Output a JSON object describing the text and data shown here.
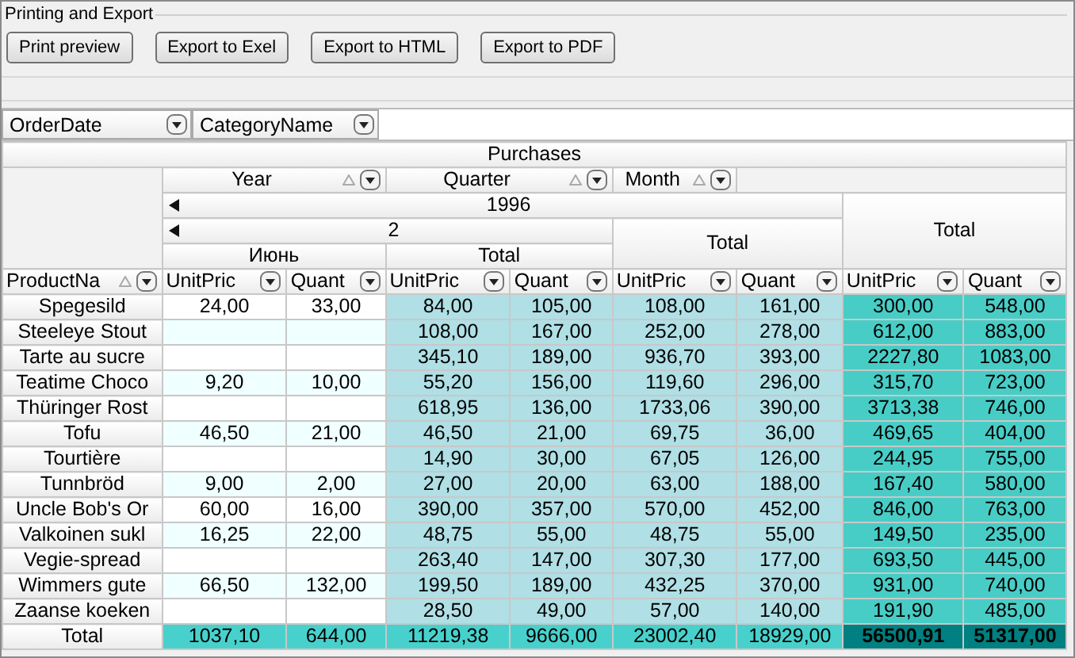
{
  "panel": {
    "title": "Printing and Export",
    "buttons": [
      "Print preview",
      "Export to Exel",
      "Export to HTML",
      "Export to PDF"
    ]
  },
  "filter_fields": [
    {
      "label": "OrderDate"
    },
    {
      "label": "CategoryName"
    }
  ],
  "pivot": {
    "title": "Purchases",
    "column_fields": [
      {
        "label": "Year",
        "sorted": true
      },
      {
        "label": "Quarter",
        "sorted": true
      },
      {
        "label": "Month",
        "sorted": true
      }
    ],
    "year": {
      "label": "1996",
      "expanded": true
    },
    "quarter": {
      "label": "2",
      "expanded": true
    },
    "month": {
      "label": "Июнь"
    },
    "month_total": "Total",
    "quarter_total": "Total",
    "grand_total": "Total",
    "row_field": {
      "label": "ProductNa",
      "sorted": true
    },
    "measures": [
      {
        "label": "UnitPric",
        "kind": "month"
      },
      {
        "label": "Quant",
        "kind": "month"
      },
      {
        "label": "UnitPric",
        "kind": "subtotal"
      },
      {
        "label": "Quant",
        "kind": "subtotal"
      },
      {
        "label": "UnitPric",
        "kind": "subtotal"
      },
      {
        "label": "Quant",
        "kind": "subtotal"
      },
      {
        "label": "UnitPric",
        "kind": "grand"
      },
      {
        "label": "Quant",
        "kind": "grand"
      }
    ],
    "rows": [
      {
        "product": "Spegesild",
        "cells": [
          "24,00",
          "33,00",
          "84,00",
          "105,00",
          "108,00",
          "161,00",
          "300,00",
          "548,00"
        ]
      },
      {
        "product": "Steeleye Stout",
        "cells": [
          null,
          null,
          "108,00",
          "167,00",
          "252,00",
          "278,00",
          "612,00",
          "883,00"
        ]
      },
      {
        "product": "Tarte au sucre",
        "cells": [
          null,
          null,
          "345,10",
          "189,00",
          "936,70",
          "393,00",
          "2227,80",
          "1083,00"
        ]
      },
      {
        "product": "Teatime Choco",
        "cells": [
          "9,20",
          "10,00",
          "55,20",
          "156,00",
          "119,60",
          "296,00",
          "315,70",
          "723,00"
        ]
      },
      {
        "product": "Thüringer Rost",
        "cells": [
          null,
          null,
          "618,95",
          "136,00",
          "1733,06",
          "390,00",
          "3713,38",
          "746,00"
        ]
      },
      {
        "product": "Tofu",
        "cells": [
          "46,50",
          "21,00",
          "46,50",
          "21,00",
          "69,75",
          "36,00",
          "469,65",
          "404,00"
        ]
      },
      {
        "product": "Tourtière",
        "cells": [
          null,
          null,
          "14,90",
          "30,00",
          "67,05",
          "126,00",
          "244,95",
          "755,00"
        ]
      },
      {
        "product": "Tunnbröd",
        "cells": [
          "9,00",
          "2,00",
          "27,00",
          "20,00",
          "63,00",
          "188,00",
          "167,40",
          "580,00"
        ]
      },
      {
        "product": "Uncle Bob's Or",
        "cells": [
          "60,00",
          "16,00",
          "390,00",
          "357,00",
          "570,00",
          "452,00",
          "846,00",
          "763,00"
        ]
      },
      {
        "product": "Valkoinen sukl",
        "cells": [
          "16,25",
          "22,00",
          "48,75",
          "55,00",
          "48,75",
          "55,00",
          "149,50",
          "235,00"
        ]
      },
      {
        "product": "Vegie-spread",
        "cells": [
          null,
          null,
          "263,40",
          "147,00",
          "307,30",
          "177,00",
          "693,50",
          "445,00"
        ]
      },
      {
        "product": "Wimmers gute",
        "cells": [
          "66,50",
          "132,00",
          "199,50",
          "189,00",
          "432,25",
          "370,00",
          "931,00",
          "740,00"
        ]
      },
      {
        "product": "Zaanse koeken",
        "cells": [
          null,
          null,
          "28,50",
          "49,00",
          "57,00",
          "140,00",
          "191,90",
          "485,00"
        ]
      }
    ],
    "totals_row": {
      "label": "Total",
      "cells": [
        "1037,10",
        "644,00",
        "11219,38",
        "9666,00",
        "23002,40",
        "18929,00",
        "56500,91",
        "51317,00"
      ]
    }
  }
}
